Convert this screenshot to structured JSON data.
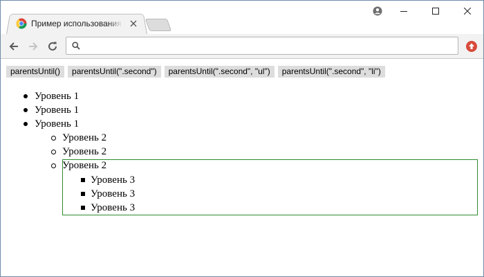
{
  "browser": {
    "tab_title": "Пример использования",
    "omnibox_value": "",
    "accent": "#2e8b2e"
  },
  "icons": {
    "favicon": "chrome-favicon",
    "tab_close": "close-icon",
    "new_tab": "new-tab-icon",
    "profile": "profile-icon",
    "minimize": "minimize-icon",
    "maximize": "maximize-icon",
    "close": "close-icon",
    "back": "back-arrow-icon",
    "forward": "forward-arrow-icon",
    "reload": "reload-icon",
    "search": "search-icon",
    "extension": "extension-icon"
  },
  "buttons": [
    {
      "label": "parentsUntil()"
    },
    {
      "label": "parentsUntil(\".second\")"
    },
    {
      "label": "parentsUntil(\".second\", \"ul\")"
    },
    {
      "label": "parentsUntil(\".second\", \"li\")"
    }
  ],
  "list": {
    "level1": [
      "Уровень 1",
      "Уровень 1",
      "Уровень 1"
    ],
    "level2": [
      "Уровень 2",
      "Уровень 2",
      "Уровень 2"
    ],
    "level3": [
      "Уровень 3",
      "Уровень 3",
      "Уровень 3"
    ]
  }
}
